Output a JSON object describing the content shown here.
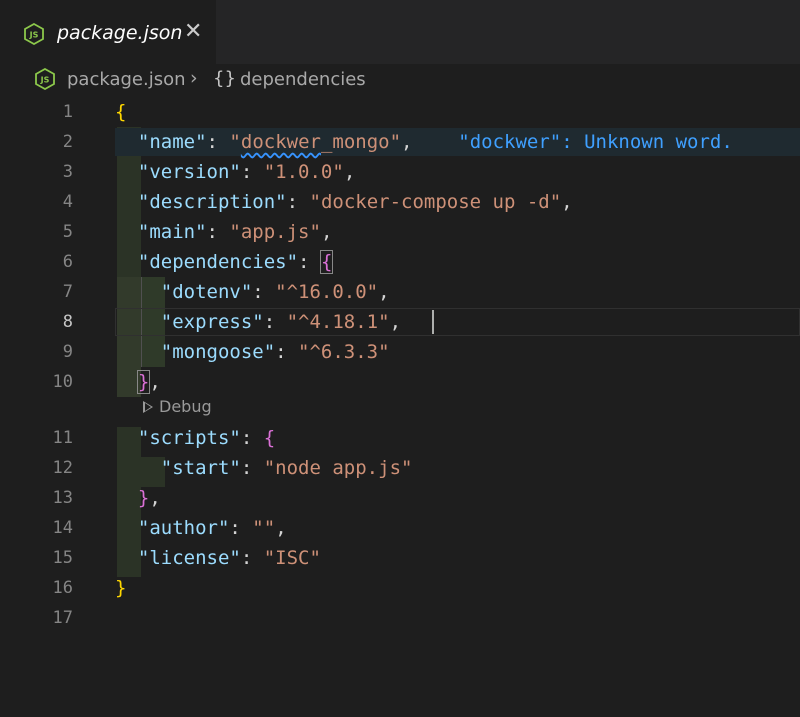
{
  "tab": {
    "label": "package.json",
    "close_glyph": "✕",
    "icon": "nodejs-icon"
  },
  "breadcrumb": {
    "file": "package.json",
    "separator": "›",
    "symbol_icon": "{}",
    "symbol": "dependencies"
  },
  "editor": {
    "active_line": 8,
    "codelens": {
      "label": "Debug"
    },
    "hint": "\"dockwer\": Unknown word.",
    "lines": [
      {
        "n": "1"
      },
      {
        "n": "2"
      },
      {
        "n": "3"
      },
      {
        "n": "4"
      },
      {
        "n": "5"
      },
      {
        "n": "6"
      },
      {
        "n": "7"
      },
      {
        "n": "8"
      },
      {
        "n": "9"
      },
      {
        "n": "10"
      },
      {
        "n": "11"
      },
      {
        "n": "12"
      },
      {
        "n": "13"
      },
      {
        "n": "14"
      },
      {
        "n": "15"
      },
      {
        "n": "16"
      },
      {
        "n": "17"
      }
    ],
    "tokens": {
      "open_brace": "{",
      "close_brace": "}",
      "name_key": "\"name\"",
      "name_q1": "\"",
      "name_word": "dockwer",
      "name_rest": "_mongo\"",
      "version_key": "\"version\"",
      "version_val": "\"1.0.0\"",
      "description_key": "\"description\"",
      "description_val": "\"docker-compose up -d\"",
      "main_key": "\"main\"",
      "main_val": "\"app.js\"",
      "dependencies_key": "\"dependencies\"",
      "dotenv_key": "\"dotenv\"",
      "dotenv_val": "\"^16.0.0\"",
      "express_key": "\"express\"",
      "express_val": "\"^4.18.1\"",
      "mongoose_key": "\"mongoose\"",
      "mongoose_val": "\"^6.3.3\"",
      "scripts_key": "\"scripts\"",
      "start_key": "\"start\"",
      "start_val": "\"node app.js\"",
      "author_key": "\"author\"",
      "author_val": "\"\"",
      "license_key": "\"license\"",
      "license_val": "\"ISC\"",
      "colon": ": ",
      "comma": ","
    }
  },
  "colors": {
    "background": "#1e1e1e",
    "key": "#9cdcfe",
    "string": "#ce9178",
    "bracket_level1": "#ffd700",
    "bracket_level2": "#da70d6",
    "hint": "#3fa0ff"
  }
}
